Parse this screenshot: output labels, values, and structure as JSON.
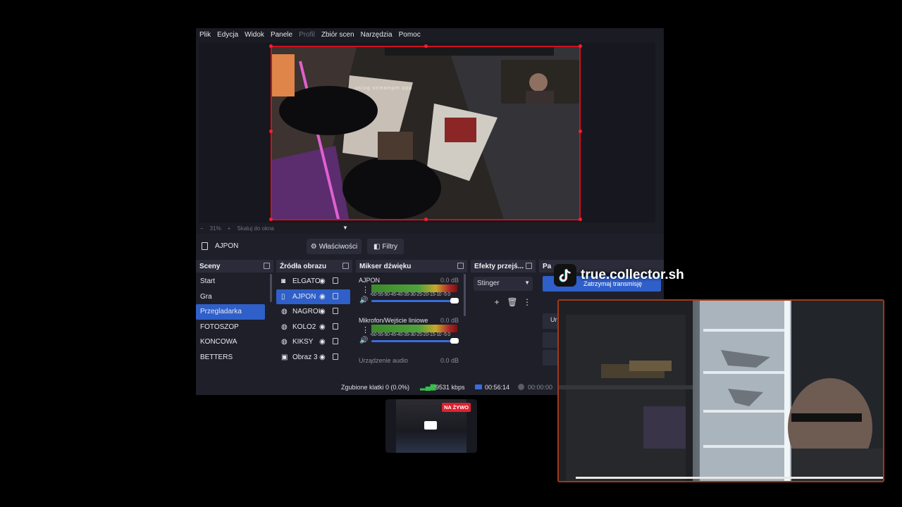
{
  "menu": [
    "Plik",
    "Edycja",
    "Widok",
    "Panele",
    "Profil",
    "Zbiór scen",
    "Narzędzia",
    "Pomoc"
  ],
  "menu_disabled": [
    "Profil"
  ],
  "preview": {
    "overlay_text": "using streampm.app",
    "zoom_minus": "−",
    "zoom_value": "31%",
    "zoom_plus": "+",
    "zoom_mode": "Skaluj do okna"
  },
  "source_toolbar": {
    "selected_source": "AJPON",
    "properties_label": "Właściwości",
    "filters_label": "Filtry"
  },
  "scenes": {
    "title": "Sceny",
    "items": [
      "Start",
      "Gra",
      "Przegladarka",
      "FOTOSZOP",
      "KONCOWA",
      "BETTERS"
    ],
    "active": "Przegladarka"
  },
  "sources": {
    "title": "Źródła obrazu",
    "items": [
      "ELGATO",
      "AJPON",
      "NAGROI",
      "KOLO2",
      "KIKSY",
      "Obraz 3"
    ],
    "active": "AJPON"
  },
  "mixer": {
    "title": "Mikser dźwięku",
    "tracks": [
      {
        "name": "AJPON",
        "db": "0.0 dB",
        "scale": "-60-55-50-45-40-35-30-25-20-15-10 -5  0"
      },
      {
        "name": "Mikrofon/Wejście liniowe",
        "db": "0.0 dB",
        "scale": "-60-55-50-45-40-35-30-25-20-15-10 -5  0"
      },
      {
        "name": "Urządzenie audio",
        "db": "0.0 dB",
        "scale": ""
      }
    ]
  },
  "transitions": {
    "title": "Efekty przejś...",
    "selected": "Stinger"
  },
  "controls": {
    "title": "Pa",
    "stream_button": "Zatrzymaj transmisję",
    "small_label": "Ur"
  },
  "status": {
    "dropped_frames": "Zgubione klatki 0 (0.0%)",
    "bitrate": "9531 kbps",
    "stream_time": "00:56:14",
    "record_time": "00:00:00"
  },
  "live_badge": "NA ŻYWO",
  "tiktok_handle": "true.collector.sh",
  "colors": {
    "accent_blue": "#2f5fc9",
    "selection_red": "#d0101c",
    "live_red": "#e0202e",
    "bitrate_green": "#35c04a"
  }
}
